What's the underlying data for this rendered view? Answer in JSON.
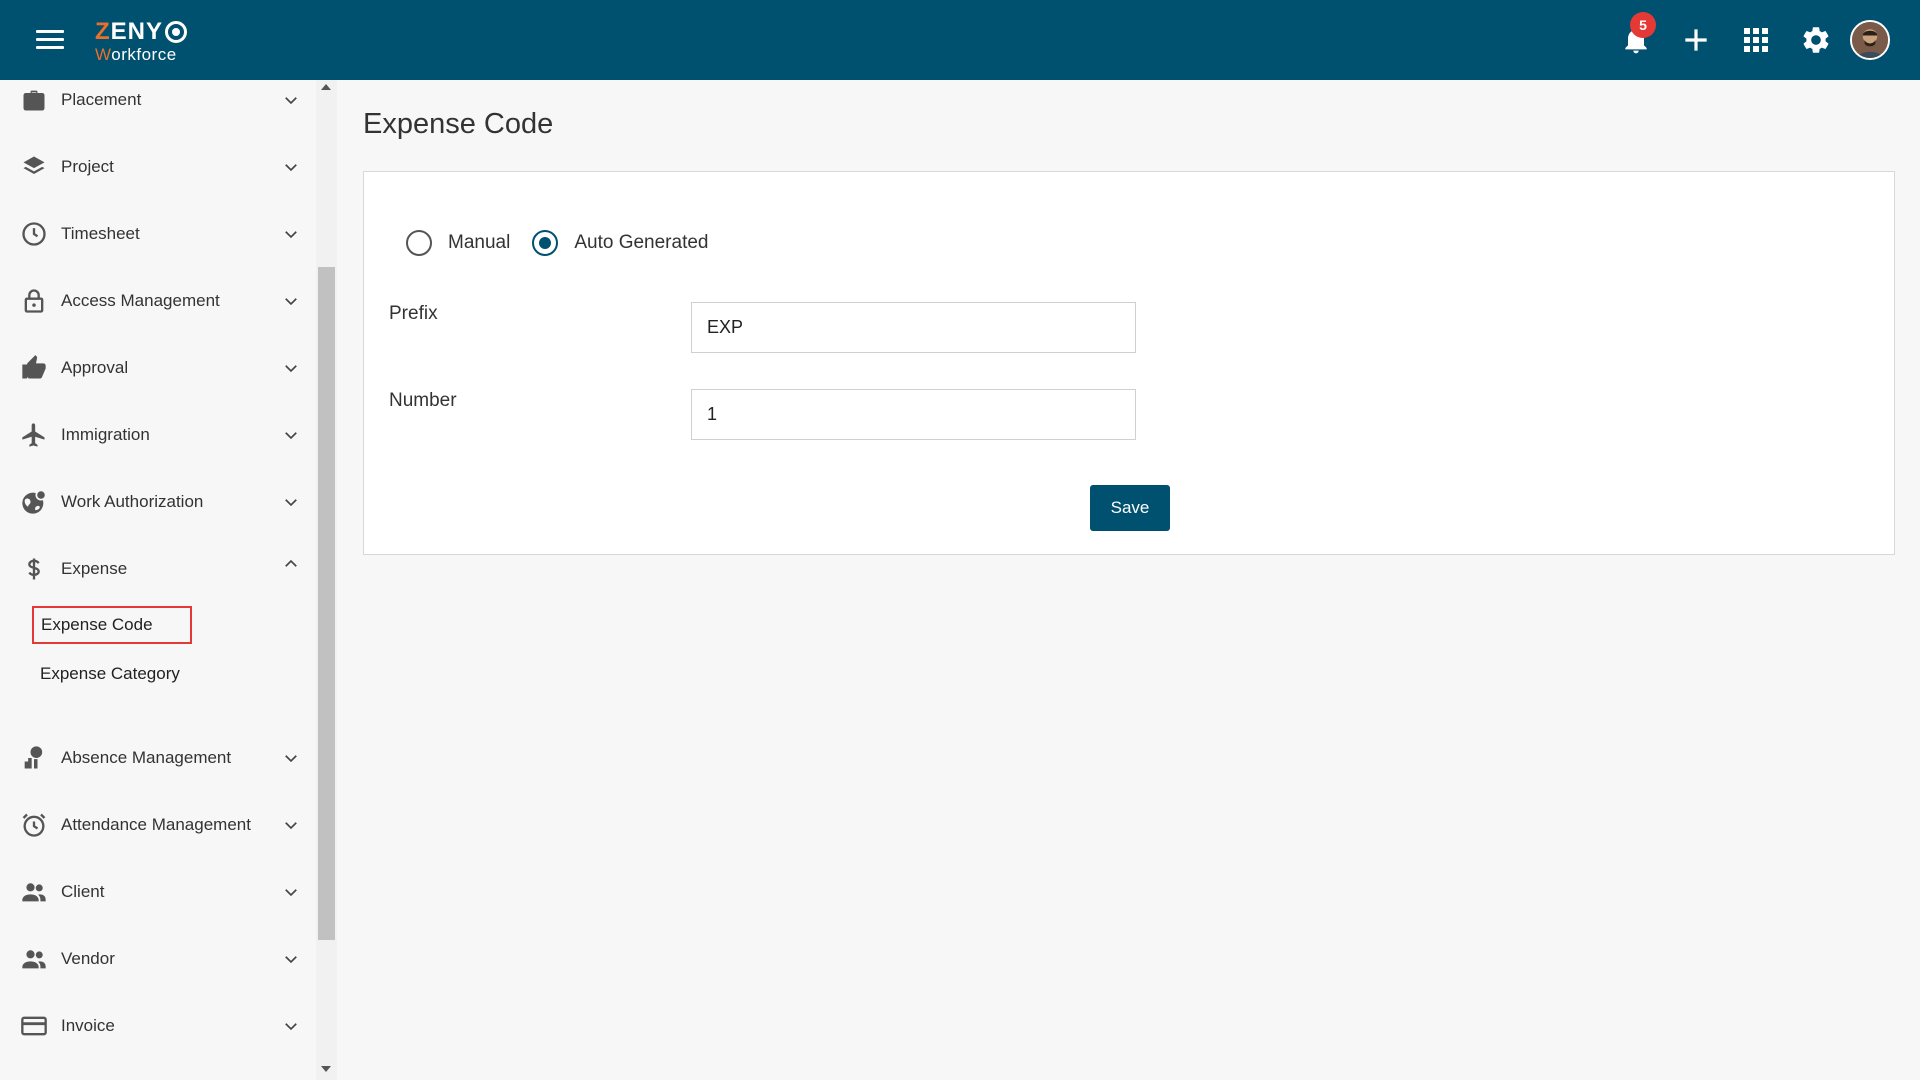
{
  "header": {
    "logo_brand": "ZENY",
    "logo_sub": "Workforce",
    "notification_count": "5",
    "icons": [
      "menu-icon",
      "bell-icon",
      "plus-icon",
      "apps-grid-icon",
      "gear-icon",
      "avatar"
    ]
  },
  "sidebar": {
    "items": [
      {
        "label": "Placement",
        "icon": "briefcase-icon",
        "expanded": false
      },
      {
        "label": "Project",
        "icon": "layers-icon",
        "expanded": false
      },
      {
        "label": "Timesheet",
        "icon": "clock-icon",
        "expanded": false
      },
      {
        "label": "Access Management",
        "icon": "lock-icon",
        "expanded": false
      },
      {
        "label": "Approval",
        "icon": "thumbs-up-icon",
        "expanded": false
      },
      {
        "label": "Immigration",
        "icon": "airplane-icon",
        "expanded": false
      },
      {
        "label": "Work Authorization",
        "icon": "globe-icon",
        "expanded": false
      },
      {
        "label": "Expense",
        "icon": "dollar-icon",
        "expanded": true
      },
      {
        "label": "Absence Management",
        "icon": "person-absent-icon",
        "expanded": false
      },
      {
        "label": "Attendance Management",
        "icon": "alarm-clock-icon",
        "expanded": false
      },
      {
        "label": "Client",
        "icon": "people-icon",
        "expanded": false
      },
      {
        "label": "Vendor",
        "icon": "people-icon",
        "expanded": false
      },
      {
        "label": "Invoice",
        "icon": "card-icon",
        "expanded": false
      }
    ],
    "expense_sub": [
      {
        "label": "Expense Code",
        "active": true
      },
      {
        "label": "Expense Category",
        "active": false
      }
    ]
  },
  "main": {
    "title": "Expense Code",
    "mode_options": [
      {
        "label": "Manual",
        "checked": false
      },
      {
        "label": "Auto Generated",
        "checked": true
      }
    ],
    "prefix_label": "Prefix",
    "prefix_value": "EXP",
    "number_label": "Number",
    "number_value": "1",
    "save_label": "Save"
  },
  "colors": {
    "header_bg": "#005070",
    "accent_orange": "#e8702a",
    "badge_red": "#e53935",
    "active_outline": "#e53935"
  }
}
